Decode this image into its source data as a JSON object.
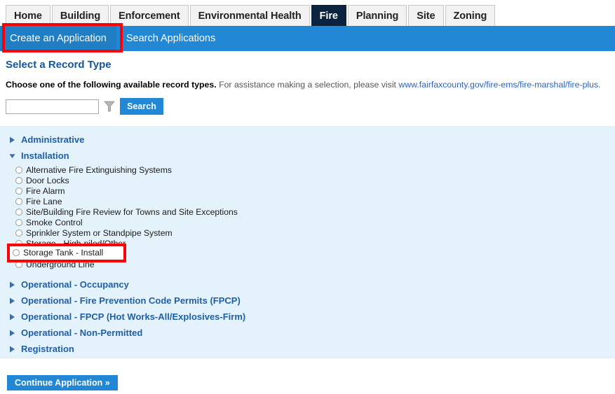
{
  "nav": {
    "tabs": [
      {
        "label": "Home",
        "active": false
      },
      {
        "label": "Building",
        "active": false
      },
      {
        "label": "Enforcement",
        "active": false
      },
      {
        "label": "Environmental Health",
        "active": false
      },
      {
        "label": "Fire",
        "active": true
      },
      {
        "label": "Planning",
        "active": false
      },
      {
        "label": "Site",
        "active": false
      },
      {
        "label": "Zoning",
        "active": false
      }
    ]
  },
  "subnav": {
    "items": [
      {
        "label": "Create an Application",
        "selected": true
      },
      {
        "label": "Search Applications",
        "selected": false
      }
    ]
  },
  "main": {
    "title": "Select a Record Type",
    "instruction_bold": "Choose one of the following available record types.",
    "instruction_rest": "For assistance making a selection, please visit",
    "link_text": "www.fairfaxcounty.gov/fire-ems/fire-marshal/fire-plus.",
    "search": {
      "value": "",
      "placeholder": "",
      "filter_icon": "funnel-icon",
      "button_label": "Search"
    },
    "groups": [
      {
        "label": "Administrative",
        "expanded": false,
        "options": []
      },
      {
        "label": "Installation",
        "expanded": true,
        "options": [
          "Alternative Fire Extinguishing Systems",
          "Door Locks",
          "Fire Alarm",
          "Fire Lane",
          "Site/Building Fire Review for Towns and Site Exceptions",
          "Smoke Control",
          "Sprinkler System or Standpipe System",
          "Storage - High-piled/Other",
          "Storage Tank - Install",
          "Underground Line"
        ]
      },
      {
        "label": "Operational - Occupancy",
        "expanded": false,
        "options": []
      },
      {
        "label": "Operational - Fire Prevention Code Permits (FPCP)",
        "expanded": false,
        "options": []
      },
      {
        "label": "Operational - FPCP (Hot Works-All/Explosives-Firm)",
        "expanded": false,
        "options": []
      },
      {
        "label": "Operational - Non-Permitted",
        "expanded": false,
        "options": []
      },
      {
        "label": "Registration",
        "expanded": false,
        "options": []
      }
    ],
    "continue_label": "Continue Application »"
  },
  "annotations": {
    "highlight_color": "#fb0007",
    "boxes": [
      {
        "target": "Create an Application"
      },
      {
        "target": "Storage Tank - Install"
      }
    ],
    "highlighted_option_label": "Storage Tank - Install"
  }
}
